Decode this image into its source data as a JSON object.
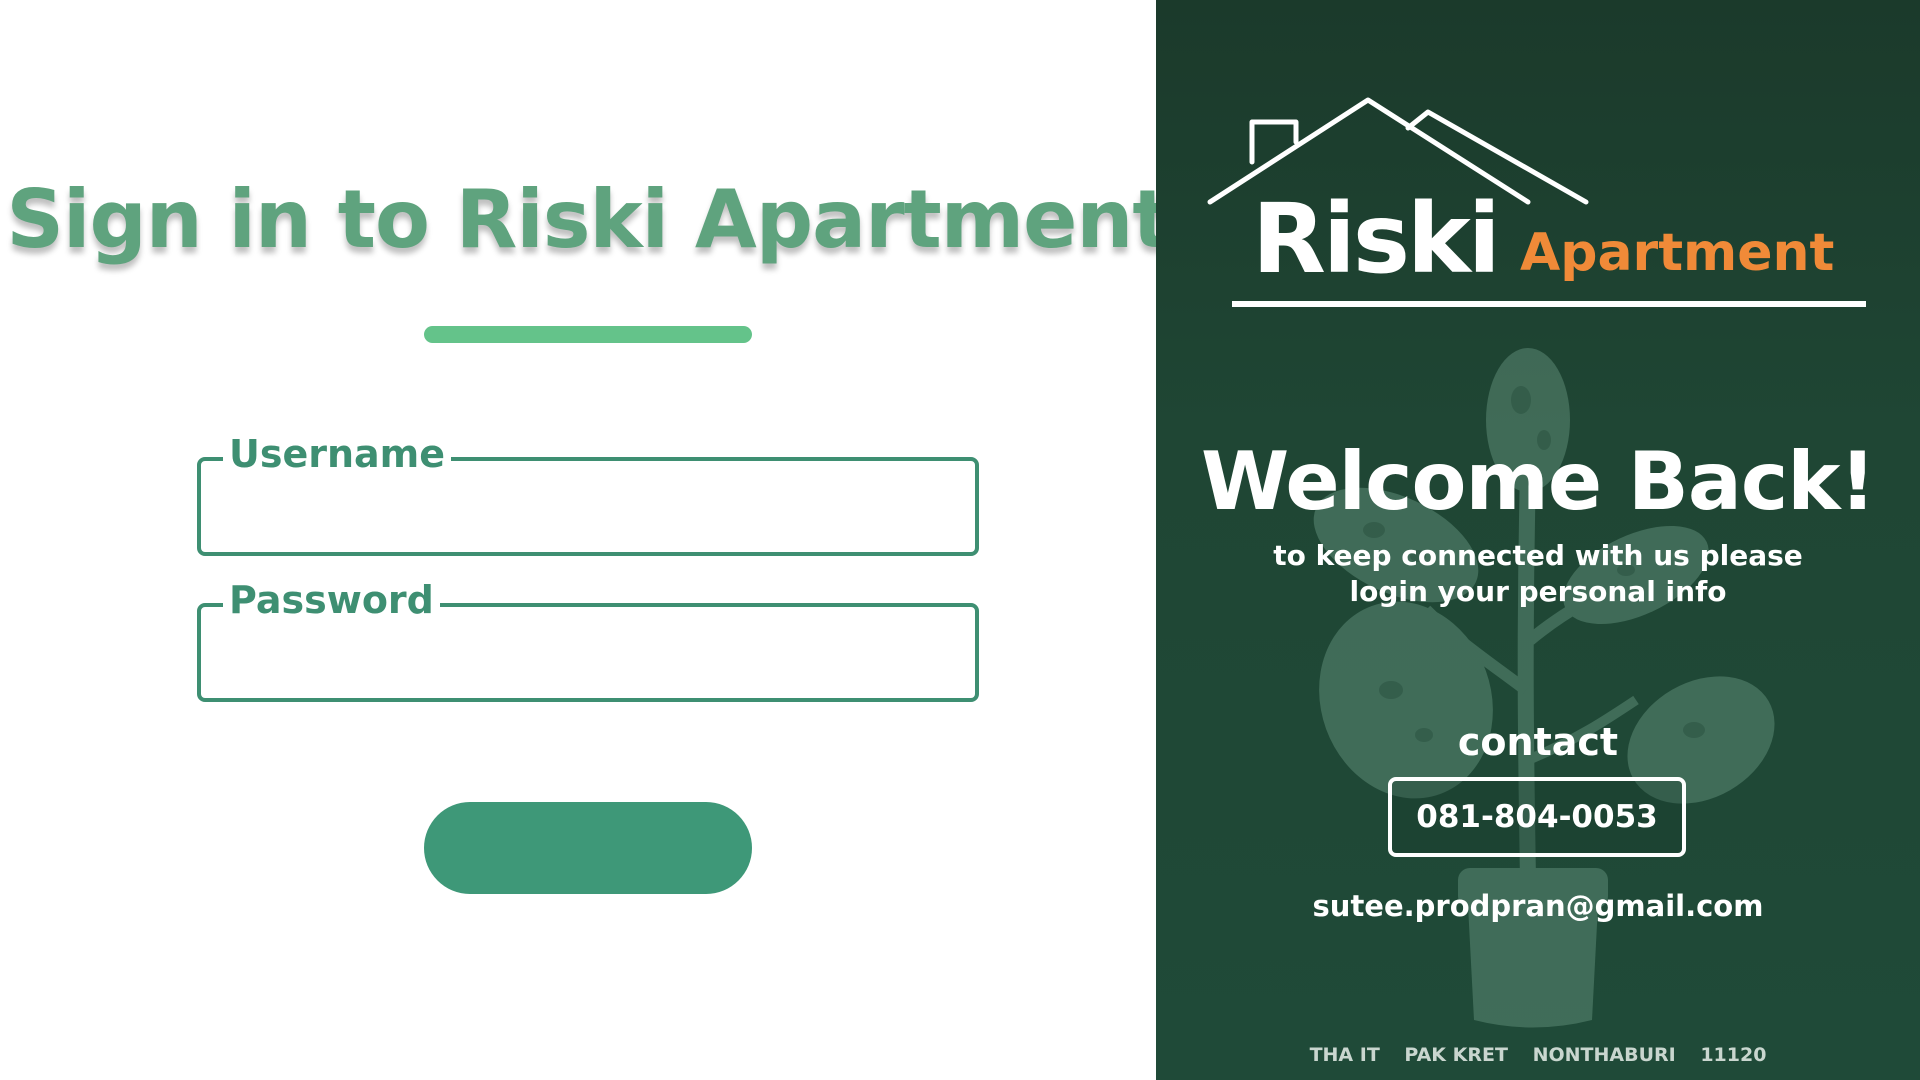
{
  "colors": {
    "brand_green": "#5fa37e",
    "accent_green": "#64c38a",
    "field_border": "#3e8f72",
    "field_label": "#3e8f72",
    "button_bg": "#3e9878",
    "right_panel_bg": "#1f4634",
    "logo_orange": "#f08a38"
  },
  "signin": {
    "title": "Sign in to Riski Apartment",
    "username_label": "Username",
    "username_value": "",
    "password_label": "Password",
    "password_value": "",
    "login_button_label": ""
  },
  "brand": {
    "logo_primary": "Riski",
    "logo_secondary": "Apartment",
    "logo_icon": "house-roof-icon"
  },
  "welcome": {
    "heading": "Welcome Back!",
    "sub_line_1": "to keep connected with us please",
    "sub_line_2": "login your personal info"
  },
  "contact": {
    "heading": "contact",
    "phone": "081-804-0053",
    "email": "sutee.prodpran@gmail.com"
  },
  "address": {
    "parts": [
      "THA IT",
      "PAK KRET",
      "NONTHABURI",
      "11120"
    ]
  },
  "background_image": "potted-plant-illustration"
}
